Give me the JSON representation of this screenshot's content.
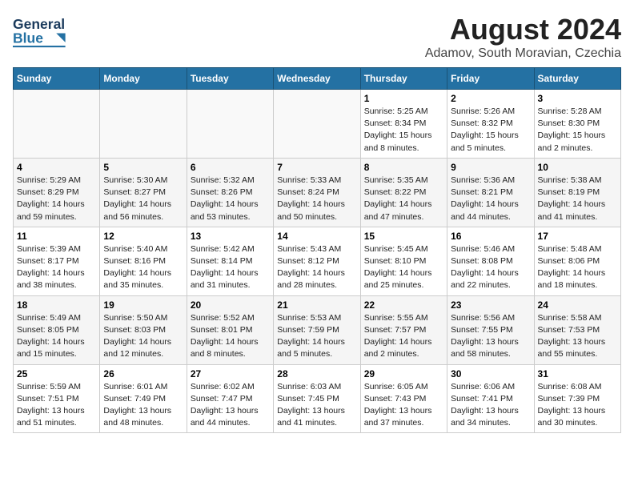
{
  "header": {
    "logo_line1": "General",
    "logo_line2": "Blue",
    "title": "August 2024",
    "subtitle": "Adamov, South Moravian, Czechia"
  },
  "days_of_week": [
    "Sunday",
    "Monday",
    "Tuesday",
    "Wednesday",
    "Thursday",
    "Friday",
    "Saturday"
  ],
  "weeks": [
    [
      {
        "day": "",
        "info": ""
      },
      {
        "day": "",
        "info": ""
      },
      {
        "day": "",
        "info": ""
      },
      {
        "day": "",
        "info": ""
      },
      {
        "day": "1",
        "sunrise": "5:25 AM",
        "sunset": "8:34 PM",
        "daylight": "15 hours and 8 minutes."
      },
      {
        "day": "2",
        "sunrise": "5:26 AM",
        "sunset": "8:32 PM",
        "daylight": "15 hours and 5 minutes."
      },
      {
        "day": "3",
        "sunrise": "5:28 AM",
        "sunset": "8:30 PM",
        "daylight": "15 hours and 2 minutes."
      }
    ],
    [
      {
        "day": "4",
        "sunrise": "5:29 AM",
        "sunset": "8:29 PM",
        "daylight": "14 hours and 59 minutes."
      },
      {
        "day": "5",
        "sunrise": "5:30 AM",
        "sunset": "8:27 PM",
        "daylight": "14 hours and 56 minutes."
      },
      {
        "day": "6",
        "sunrise": "5:32 AM",
        "sunset": "8:26 PM",
        "daylight": "14 hours and 53 minutes."
      },
      {
        "day": "7",
        "sunrise": "5:33 AM",
        "sunset": "8:24 PM",
        "daylight": "14 hours and 50 minutes."
      },
      {
        "day": "8",
        "sunrise": "5:35 AM",
        "sunset": "8:22 PM",
        "daylight": "14 hours and 47 minutes."
      },
      {
        "day": "9",
        "sunrise": "5:36 AM",
        "sunset": "8:21 PM",
        "daylight": "14 hours and 44 minutes."
      },
      {
        "day": "10",
        "sunrise": "5:38 AM",
        "sunset": "8:19 PM",
        "daylight": "14 hours and 41 minutes."
      }
    ],
    [
      {
        "day": "11",
        "sunrise": "5:39 AM",
        "sunset": "8:17 PM",
        "daylight": "14 hours and 38 minutes."
      },
      {
        "day": "12",
        "sunrise": "5:40 AM",
        "sunset": "8:16 PM",
        "daylight": "14 hours and 35 minutes."
      },
      {
        "day": "13",
        "sunrise": "5:42 AM",
        "sunset": "8:14 PM",
        "daylight": "14 hours and 31 minutes."
      },
      {
        "day": "14",
        "sunrise": "5:43 AM",
        "sunset": "8:12 PM",
        "daylight": "14 hours and 28 minutes."
      },
      {
        "day": "15",
        "sunrise": "5:45 AM",
        "sunset": "8:10 PM",
        "daylight": "14 hours and 25 minutes."
      },
      {
        "day": "16",
        "sunrise": "5:46 AM",
        "sunset": "8:08 PM",
        "daylight": "14 hours and 22 minutes."
      },
      {
        "day": "17",
        "sunrise": "5:48 AM",
        "sunset": "8:06 PM",
        "daylight": "14 hours and 18 minutes."
      }
    ],
    [
      {
        "day": "18",
        "sunrise": "5:49 AM",
        "sunset": "8:05 PM",
        "daylight": "14 hours and 15 minutes."
      },
      {
        "day": "19",
        "sunrise": "5:50 AM",
        "sunset": "8:03 PM",
        "daylight": "14 hours and 12 minutes."
      },
      {
        "day": "20",
        "sunrise": "5:52 AM",
        "sunset": "8:01 PM",
        "daylight": "14 hours and 8 minutes."
      },
      {
        "day": "21",
        "sunrise": "5:53 AM",
        "sunset": "7:59 PM",
        "daylight": "14 hours and 5 minutes."
      },
      {
        "day": "22",
        "sunrise": "5:55 AM",
        "sunset": "7:57 PM",
        "daylight": "14 hours and 2 minutes."
      },
      {
        "day": "23",
        "sunrise": "5:56 AM",
        "sunset": "7:55 PM",
        "daylight": "13 hours and 58 minutes."
      },
      {
        "day": "24",
        "sunrise": "5:58 AM",
        "sunset": "7:53 PM",
        "daylight": "13 hours and 55 minutes."
      }
    ],
    [
      {
        "day": "25",
        "sunrise": "5:59 AM",
        "sunset": "7:51 PM",
        "daylight": "13 hours and 51 minutes."
      },
      {
        "day": "26",
        "sunrise": "6:01 AM",
        "sunset": "7:49 PM",
        "daylight": "13 hours and 48 minutes."
      },
      {
        "day": "27",
        "sunrise": "6:02 AM",
        "sunset": "7:47 PM",
        "daylight": "13 hours and 44 minutes."
      },
      {
        "day": "28",
        "sunrise": "6:03 AM",
        "sunset": "7:45 PM",
        "daylight": "13 hours and 41 minutes."
      },
      {
        "day": "29",
        "sunrise": "6:05 AM",
        "sunset": "7:43 PM",
        "daylight": "13 hours and 37 minutes."
      },
      {
        "day": "30",
        "sunrise": "6:06 AM",
        "sunset": "7:41 PM",
        "daylight": "13 hours and 34 minutes."
      },
      {
        "day": "31",
        "sunrise": "6:08 AM",
        "sunset": "7:39 PM",
        "daylight": "13 hours and 30 minutes."
      }
    ]
  ],
  "labels": {
    "sunrise": "Sunrise:",
    "sunset": "Sunset:",
    "daylight": "Daylight:"
  }
}
